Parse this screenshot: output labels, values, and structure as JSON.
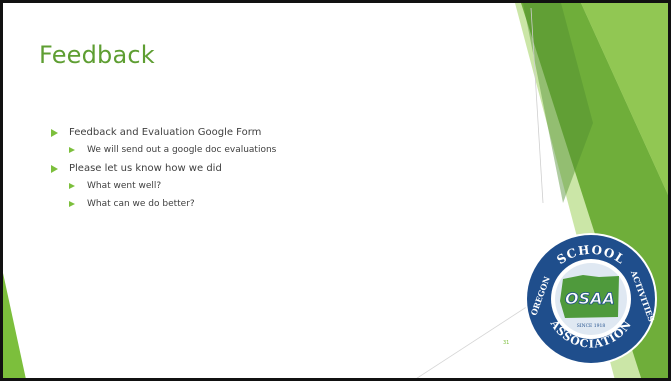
{
  "slide": {
    "title": "Feedback",
    "bullets": [
      {
        "level": 1,
        "text": "Feedback and Evaluation Google Form"
      },
      {
        "level": 2,
        "text": "We will send out a google doc evaluations"
      },
      {
        "level": 1,
        "text": "Please let us know how we did"
      },
      {
        "level": 2,
        "text": "What went well?"
      },
      {
        "level": 2,
        "text": "What can we do better?"
      }
    ],
    "page_number": "31"
  },
  "logo": {
    "ring_top": "SCHOOL",
    "ring_left": "OREGON",
    "ring_right": "ACTIVITIES",
    "ring_bottom": "ASSOCIATION",
    "center": "OSAA",
    "since": "SINCE 1918"
  },
  "colors": {
    "accent": "#7cbf3c",
    "title": "#5e9e32",
    "logo_blue": "#1f4e8c",
    "logo_green": "#4f9a3c"
  }
}
